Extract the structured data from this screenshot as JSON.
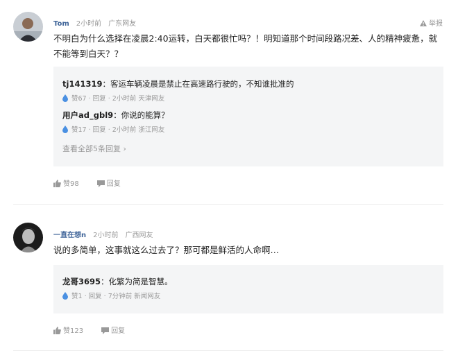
{
  "comments": [
    {
      "user": "Tom",
      "time": "2小时前",
      "location": "广东网友",
      "report_label": "举报",
      "text": "不明白为什么选择在凌晨2:40运转，白天都很忙吗？！明知道那个时间段路况差、人的精神疲惫，就不能等到白天？？",
      "replies": [
        {
          "name": "tj141319",
          "sep": "：",
          "text": "客运车辆凌晨是禁止在高速路行驶的，不知谁批准的",
          "likes": "赞67",
          "reply_label": "回复",
          "time": "2小时前",
          "location": "天津网友"
        },
        {
          "name": "用户ad_gbl9",
          "sep": "：",
          "text": "你说的能算？",
          "likes": "赞17",
          "reply_label": "回复",
          "time": "2小时前",
          "location": "浙江网友"
        }
      ],
      "view_all": "查看全部5条回复 ›",
      "likes": "赞98",
      "reply_label": "回复"
    },
    {
      "user": "一直在想n",
      "time": "2小时前",
      "location": "广西网友",
      "text": "说的多简单，这事就这么过去了？那可都是鲜活的人命啊…",
      "replies": [
        {
          "name": "龙哥3695",
          "sep": "：",
          "text": "化繁为简是智慧。",
          "likes": "赞1",
          "reply_label": "回复",
          "time": "7分钟前",
          "location": "新闻网友"
        }
      ],
      "likes": "赞123",
      "reply_label": "回复"
    }
  ],
  "colors": {
    "username": "#406599",
    "meta": "#999999",
    "reply_bg": "#f4f5f6",
    "like_drop": "#4a90e2"
  },
  "icons": [
    "warning-icon",
    "water-drop-icon",
    "thumbs-up-icon",
    "comment-bubble-icon"
  ]
}
